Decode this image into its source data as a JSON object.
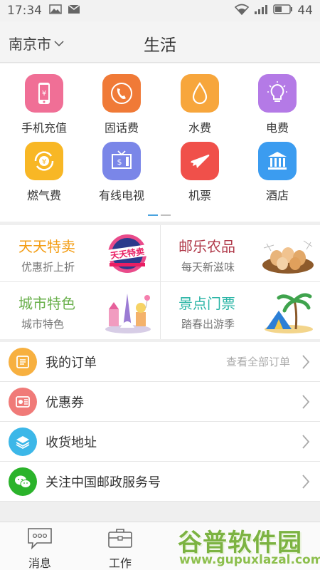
{
  "status": {
    "time": "17:34",
    "battery": "44"
  },
  "header": {
    "city": "南京市",
    "title": "生活"
  },
  "services": [
    {
      "label": "手机充值",
      "color": "#f06f96",
      "icon": "phone-icon"
    },
    {
      "label": "固话费",
      "color": "#f07a37",
      "icon": "telephone-icon"
    },
    {
      "label": "水费",
      "color": "#f7a63c",
      "icon": "water-drop-icon"
    },
    {
      "label": "电费",
      "color": "#b47ae6",
      "icon": "lightbulb-icon"
    },
    {
      "label": "燃气费",
      "color": "#f8b725",
      "icon": "gas-coin-icon"
    },
    {
      "label": "有线电视",
      "color": "#7a86e8",
      "icon": "tv-icon"
    },
    {
      "label": "机票",
      "color": "#f0504a",
      "icon": "airplane-icon"
    },
    {
      "label": "酒店",
      "color": "#3b9cf0",
      "icon": "hotel-icon"
    }
  ],
  "promos": [
    {
      "title": "天天特卖",
      "subtitle": "优惠折上折",
      "color": "#f39c12",
      "art_text": "天天特卖"
    },
    {
      "title": "邮乐农品",
      "subtitle": "每天新滋味",
      "color": "#b03a4a"
    },
    {
      "title": "城市特色",
      "subtitle": "城市特色",
      "color": "#6ab04c"
    },
    {
      "title": "景点门票",
      "subtitle": "踏春出游季",
      "color": "#2bb5a6"
    }
  ],
  "menu": [
    {
      "label": "我的订单",
      "extra": "查看全部订单",
      "color": "#f7b040",
      "icon": "orders-icon"
    },
    {
      "label": "优惠券",
      "extra": "",
      "color": "#f07a78",
      "icon": "coupon-icon"
    },
    {
      "label": "收货地址",
      "extra": "",
      "color": "#3cb7e8",
      "icon": "address-layers-icon"
    },
    {
      "label": "关注中国邮政服务号",
      "extra": "",
      "color": "#2bb32b",
      "icon": "wechat-icon"
    }
  ],
  "tabs": [
    {
      "label": "消息",
      "icon": "message-icon"
    },
    {
      "label": "工作",
      "icon": "briefcase-icon"
    }
  ],
  "watermark": {
    "name": "谷普软件园",
    "url": "www.gupuxlazal.com"
  }
}
